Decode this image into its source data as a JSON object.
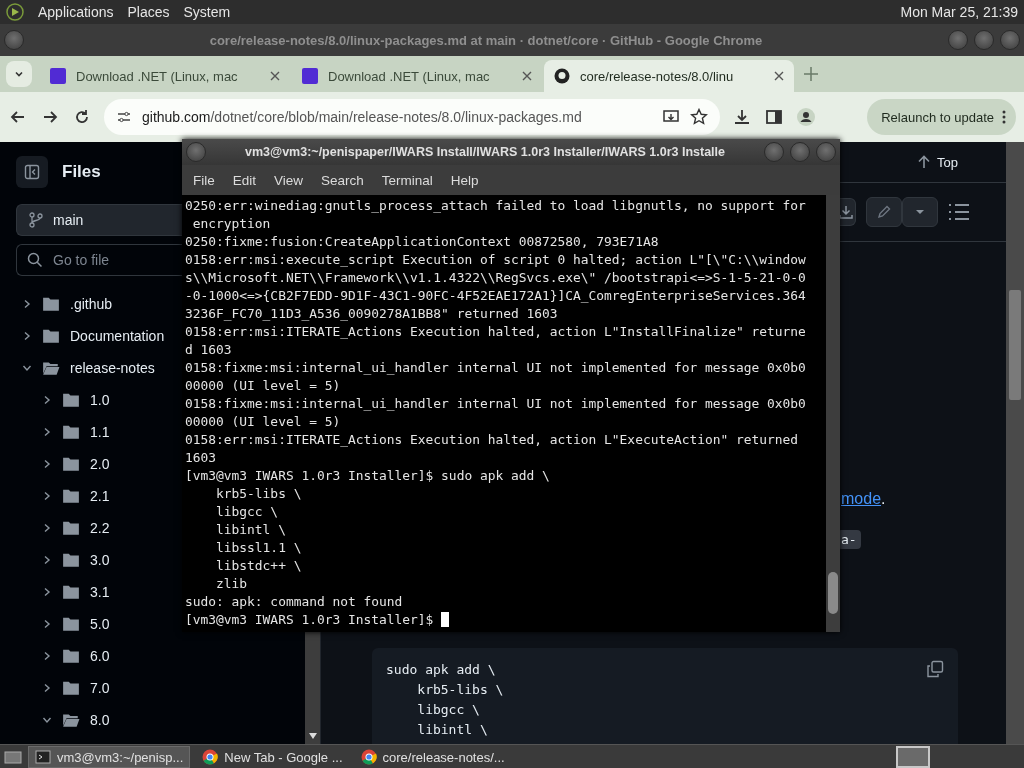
{
  "top_panel": {
    "menus": [
      "Applications",
      "Places",
      "System"
    ],
    "clock": "Mon Mar 25, 21:39"
  },
  "browser": {
    "title": "core/release-notes/8.0/linux-packages.md at main · dotnet/core · GitHub - Google Chrome",
    "tabs": [
      {
        "label": "Download .NET (Linux, mac",
        "kind": "dotnet",
        "selected": false
      },
      {
        "label": "Download .NET (Linux, mac",
        "kind": "dotnet",
        "selected": false
      },
      {
        "label": "core/release-notes/8.0/linu",
        "kind": "github",
        "selected": true
      }
    ],
    "address": {
      "host": "github.com",
      "path": "/dotnet/core/blob/main/release-notes/8.0/linux-packages.md"
    },
    "relaunch": "Relaunch to update"
  },
  "github": {
    "sidebar": {
      "title": "Files",
      "branch": "main",
      "search": {
        "placeholder": "Go to file"
      },
      "tree": [
        {
          "label": ".github",
          "expanded": false
        },
        {
          "label": "Documentation",
          "expanded": false
        },
        {
          "label": "release-notes",
          "expanded": true,
          "children": [
            {
              "label": "1.0",
              "expanded": false
            },
            {
              "label": "1.1",
              "expanded": false
            },
            {
              "label": "2.0",
              "expanded": false
            },
            {
              "label": "2.1",
              "expanded": false
            },
            {
              "label": "2.2",
              "expanded": false
            },
            {
              "label": "3.0",
              "expanded": false
            },
            {
              "label": "3.1",
              "expanded": false
            },
            {
              "label": "5.0",
              "expanded": false
            },
            {
              "label": "6.0",
              "expanded": false
            },
            {
              "label": "7.0",
              "expanded": false
            },
            {
              "label": "8.0",
              "expanded": true
            }
          ]
        }
      ]
    },
    "top_link": "Top",
    "link": "mode",
    "link_after": ".",
    "code_fragment": "a-",
    "code_block": [
      "sudo apk add \\",
      "    krb5-libs \\",
      "    libgcc \\",
      "    libintl \\"
    ]
  },
  "terminal": {
    "title": "vm3@vm3:~/penispaper/IWARS Install/IWARS 1.0r3 Installer/IWARS 1.0r3 Installe",
    "menus": [
      "File",
      "Edit",
      "View",
      "Search",
      "Terminal",
      "Help"
    ],
    "lines": [
      "0250:err:winediag:gnutls_process_attach failed to load libgnutls, no support for",
      " encryption",
      "0250:fixme:fusion:CreateApplicationContext 00872580, 793E71A8",
      "0158:err:msi:execute_script Execution of script 0 halted; action L\"[\\\"C:\\\\window",
      "s\\\\Microsoft.NET\\\\Framework\\\\v1.1.4322\\\\RegSvcs.exe\\\" /bootstrapi<=>S-1-5-21-0-0",
      "-0-1000<=>{CB2F7EDD-9D1F-43C1-90FC-4F52EAE172A1}]CA_ComregEnterpriseServices.364",
      "3236F_FC70_11D3_A536_0090278A1BB8\" returned 1603",
      "0158:err:msi:ITERATE_Actions Execution halted, action L\"InstallFinalize\" returne",
      "d 1603",
      "0158:fixme:msi:internal_ui_handler internal UI not implemented for message 0x0b0",
      "00000 (UI level = 5)",
      "0158:fixme:msi:internal_ui_handler internal UI not implemented for message 0x0b0",
      "00000 (UI level = 5)",
      "0158:err:msi:ITERATE_Actions Execution halted, action L\"ExecuteAction\" returned",
      "1603",
      "[vm3@vm3 IWARS 1.0r3 Installer]$ sudo apk add \\",
      "    krb5-libs \\",
      "    libgcc \\",
      "    libintl \\",
      "    libssl1.1 \\",
      "    libstdc++ \\",
      "    zlib",
      "sudo: apk: command not found",
      "[vm3@vm3 IWARS 1.0r3 Installer]$ "
    ]
  },
  "taskbar": {
    "items": [
      {
        "label": "vm3@vm3:~/penisp...",
        "kind": "terminal",
        "selected": true
      },
      {
        "label": "New Tab - Google ...",
        "kind": "chrome",
        "selected": false
      },
      {
        "label": "core/release-notes/...",
        "kind": "chrome",
        "selected": false
      }
    ]
  }
}
